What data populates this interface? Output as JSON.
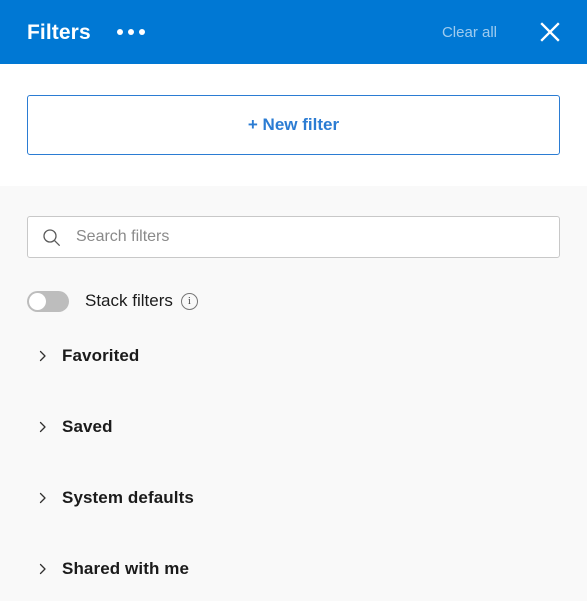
{
  "header": {
    "title": "Filters",
    "more_icon": "ellipsis-icon",
    "clear_all_label": "Clear all",
    "close_icon": "close-icon",
    "background_color": "#0078d4"
  },
  "new_filter": {
    "label": "+ New filter",
    "accent_color": "#2b7cd3"
  },
  "search": {
    "placeholder": "Search filters",
    "value": "",
    "icon": "search-icon"
  },
  "stack_filters": {
    "label": "Stack filters",
    "enabled": false,
    "info_icon": "info-icon",
    "info_glyph": "i"
  },
  "sections": [
    {
      "label": "Favorited",
      "expanded": false,
      "icon": "chevron-right-icon"
    },
    {
      "label": "Saved",
      "expanded": false,
      "icon": "chevron-right-icon"
    },
    {
      "label": "System defaults",
      "expanded": false,
      "icon": "chevron-right-icon"
    },
    {
      "label": "Shared with me",
      "expanded": false,
      "icon": "chevron-right-icon"
    }
  ]
}
